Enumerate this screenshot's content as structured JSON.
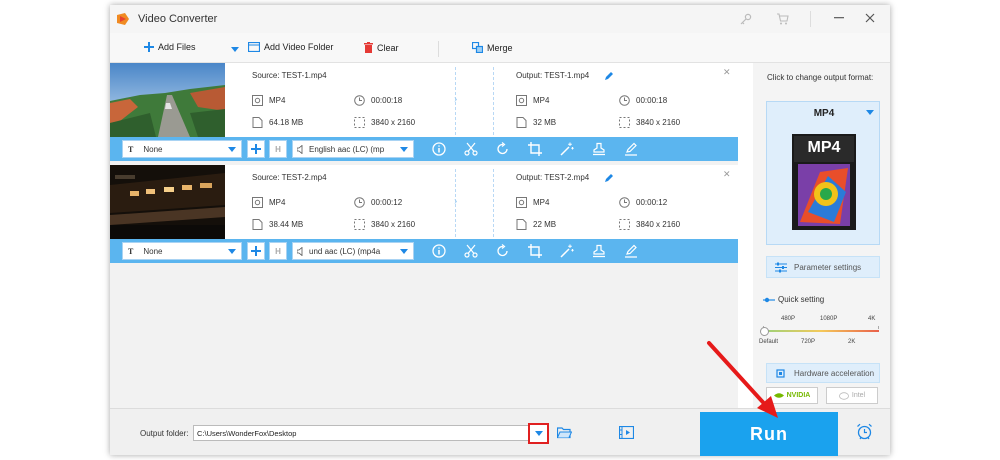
{
  "window": {
    "title": "Video Converter"
  },
  "toolbar": {
    "add_files": "Add Files",
    "add_video_folder": "Add Video Folder",
    "clear": "Clear",
    "merge": "Merge"
  },
  "items": [
    {
      "source_title": "Source: TEST-1.mp4",
      "src_format": "MP4",
      "src_duration": "00:00:18",
      "src_size": "64.18 MB",
      "src_resolution": "3840 x 2160",
      "output_title": "Output: TEST-1.mp4",
      "out_format": "MP4",
      "out_duration": "00:00:18",
      "out_size": "32 MB",
      "out_resolution": "3840 x 2160",
      "subtitle": "None",
      "audio": "English aac (LC) (mp"
    },
    {
      "source_title": "Source: TEST-2.mp4",
      "src_format": "MP4",
      "src_duration": "00:00:12",
      "src_size": "38.44 MB",
      "src_resolution": "3840 x 2160",
      "output_title": "Output: TEST-2.mp4",
      "out_format": "MP4",
      "out_duration": "00:00:12",
      "out_size": "22 MB",
      "out_resolution": "3840 x 2160",
      "subtitle": "None",
      "audio": "und aac (LC) (mp4a"
    }
  ],
  "right_panel": {
    "caption": "Click to change output format:",
    "format": "MP4",
    "format_icon_text": "MP4",
    "parameter_settings": "Parameter settings",
    "quick_setting": "Quick setting",
    "quality_top_labels": [
      "480P",
      "1080P",
      "4K"
    ],
    "quality_bottom_labels": [
      "Default",
      "720P",
      "2K"
    ],
    "hardware_acceleration": "Hardware acceleration",
    "gpu_nvidia": "NVIDIA",
    "gpu_intel": "Intel"
  },
  "bottom": {
    "output_folder_label": "Output folder:",
    "output_folder_path": "C:\\Users\\WonderFox\\Desktop",
    "run_label": "Run"
  },
  "colors": {
    "accent": "#1aa2ee",
    "strip": "#5bb5ef",
    "highlight": "#e02020"
  }
}
